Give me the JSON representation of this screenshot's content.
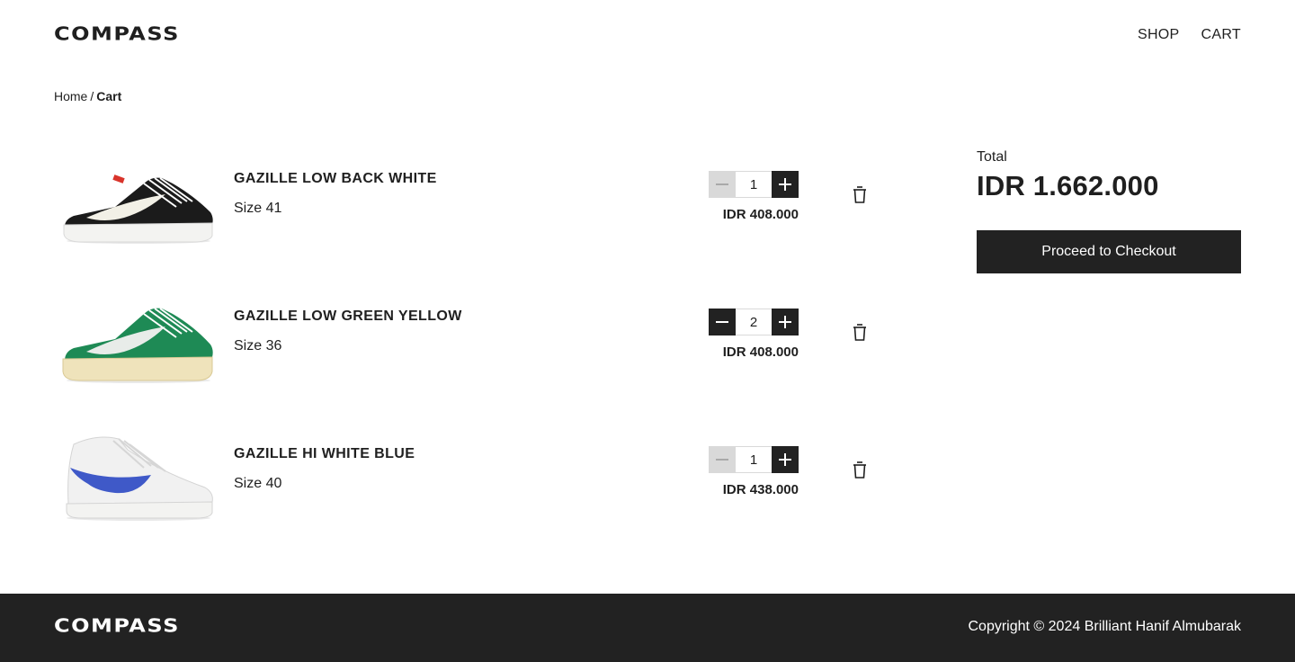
{
  "header": {
    "logo": "COMPASS",
    "nav": [
      "SHOP",
      "CART"
    ]
  },
  "breadcrumb": {
    "home": "Home",
    "separator": "/",
    "current": "Cart"
  },
  "cart": {
    "items": [
      {
        "name": "GAZILLE LOW BACK WHITE",
        "size": "Size 41",
        "quantity": "1",
        "price": "IDR 408.000",
        "colors": {
          "upper": "#1b1b1b",
          "swoosh": "#f2f0e6",
          "sole": "#f3f3f1"
        }
      },
      {
        "name": "GAZILLE LOW GREEN YELLOW",
        "size": "Size 36",
        "quantity": "2",
        "price": "IDR 408.000",
        "colors": {
          "upper": "#1e8a55",
          "swoosh": "#e8ece9",
          "sole": "#efe3bb"
        }
      },
      {
        "name": "GAZILLE HI WHITE BLUE",
        "size": "Size 40",
        "quantity": "1",
        "price": "IDR 438.000",
        "colors": {
          "upper": "#f1f1f1",
          "swoosh": "#3f59c8",
          "sole": "#f3f3f1"
        }
      }
    ]
  },
  "summary": {
    "total_label": "Total",
    "total_value": "IDR 1.662.000",
    "checkout_label": "Proceed to Checkout"
  },
  "footer": {
    "logo": "COMPASS",
    "copyright": "Copyright © 2024 Brilliant Hanif Almubarak"
  },
  "theme": {
    "dark": "#222222",
    "disabled": "#d9d9d9"
  }
}
